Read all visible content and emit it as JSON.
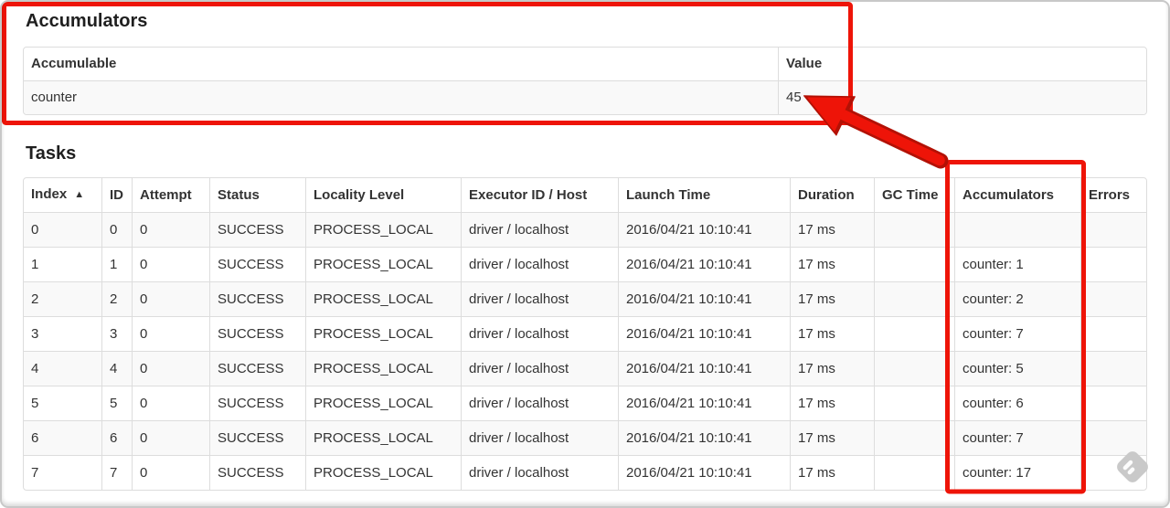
{
  "colors": {
    "annotation_red": "#ee1408",
    "annotation_red_dark": "#b31105",
    "watermark_gray": "#c9c9c9",
    "stripe": "#f9f9f9",
    "border": "#dddddd",
    "text": "#333333"
  },
  "accumulators_section": {
    "title": "Accumulators",
    "table": {
      "headers": [
        "Accumulable",
        "Value"
      ],
      "rows": [
        [
          "counter",
          "45"
        ]
      ]
    }
  },
  "tasks_section": {
    "title": "Tasks",
    "sort_icon": "▲",
    "table": {
      "headers": [
        "Index",
        "ID",
        "Attempt",
        "Status",
        "Locality Level",
        "Executor ID / Host",
        "Launch Time",
        "Duration",
        "GC Time",
        "Accumulators",
        "Errors"
      ],
      "rows": [
        [
          "0",
          "0",
          "0",
          "SUCCESS",
          "PROCESS_LOCAL",
          "driver / localhost",
          "2016/04/21 10:10:41",
          "17 ms",
          "",
          "",
          ""
        ],
        [
          "1",
          "1",
          "0",
          "SUCCESS",
          "PROCESS_LOCAL",
          "driver / localhost",
          "2016/04/21 10:10:41",
          "17 ms",
          "",
          "counter: 1",
          ""
        ],
        [
          "2",
          "2",
          "0",
          "SUCCESS",
          "PROCESS_LOCAL",
          "driver / localhost",
          "2016/04/21 10:10:41",
          "17 ms",
          "",
          "counter: 2",
          ""
        ],
        [
          "3",
          "3",
          "0",
          "SUCCESS",
          "PROCESS_LOCAL",
          "driver / localhost",
          "2016/04/21 10:10:41",
          "17 ms",
          "",
          "counter: 7",
          ""
        ],
        [
          "4",
          "4",
          "0",
          "SUCCESS",
          "PROCESS_LOCAL",
          "driver / localhost",
          "2016/04/21 10:10:41",
          "17 ms",
          "",
          "counter: 5",
          ""
        ],
        [
          "5",
          "5",
          "0",
          "SUCCESS",
          "PROCESS_LOCAL",
          "driver / localhost",
          "2016/04/21 10:10:41",
          "17 ms",
          "",
          "counter: 6",
          ""
        ],
        [
          "6",
          "6",
          "0",
          "SUCCESS",
          "PROCESS_LOCAL",
          "driver / localhost",
          "2016/04/21 10:10:41",
          "17 ms",
          "",
          "counter: 7",
          ""
        ],
        [
          "7",
          "7",
          "0",
          "SUCCESS",
          "PROCESS_LOCAL",
          "driver / localhost",
          "2016/04/21 10:10:41",
          "17 ms",
          "",
          "counter: 17",
          ""
        ]
      ]
    }
  }
}
